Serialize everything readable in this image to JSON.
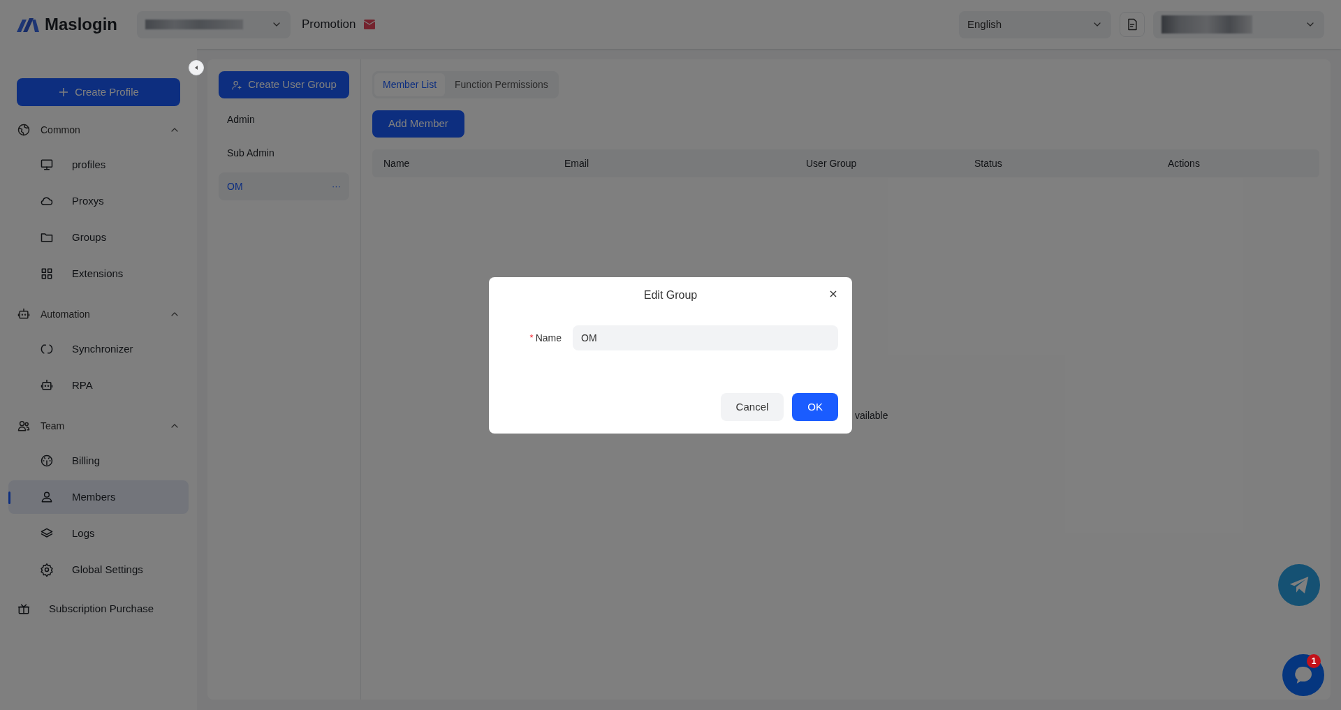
{
  "header": {
    "logo": "Maslogin",
    "promotion": "Promotion",
    "language": "English"
  },
  "sidebar": {
    "create_button": "Create Profile",
    "sections": [
      {
        "label": "Common",
        "expanded": true,
        "items": [
          {
            "label": "profiles",
            "selected": false
          },
          {
            "label": "Proxys",
            "selected": false
          },
          {
            "label": "Groups",
            "selected": false
          },
          {
            "label": "Extensions",
            "selected": false
          }
        ]
      },
      {
        "label": "Automation",
        "expanded": true,
        "items": [
          {
            "label": "Synchronizer",
            "selected": false
          },
          {
            "label": "RPA",
            "selected": false
          }
        ]
      },
      {
        "label": "Team",
        "expanded": true,
        "items": [
          {
            "label": "Billing",
            "selected": false
          },
          {
            "label": "Members",
            "selected": true
          },
          {
            "label": "Logs",
            "selected": false
          },
          {
            "label": "Global Settings",
            "selected": false
          }
        ]
      }
    ],
    "footer_item": "Subscription Purchase"
  },
  "groups": {
    "create_button": "Create User Group",
    "items": [
      {
        "label": "Admin",
        "selected": false
      },
      {
        "label": "Sub Admin",
        "selected": false
      },
      {
        "label": "OM",
        "selected": true
      }
    ],
    "more": "···"
  },
  "tabs": [
    {
      "label": "Member List",
      "selected": true
    },
    {
      "label": "Function Permissions",
      "selected": false
    }
  ],
  "add_member": "Add Member",
  "table": {
    "columns": [
      "Name",
      "Email",
      "User Group",
      "Status",
      "Actions"
    ],
    "empty_text": "vailable"
  },
  "dialog": {
    "title": "Edit Group",
    "field": {
      "label": "Name",
      "required_mark": "*",
      "value": "OM"
    },
    "buttons": [
      {
        "label": "Cancel",
        "kind": "secondary"
      },
      {
        "label": "OK",
        "kind": "primary"
      }
    ]
  },
  "chat": {
    "badge": "1"
  }
}
